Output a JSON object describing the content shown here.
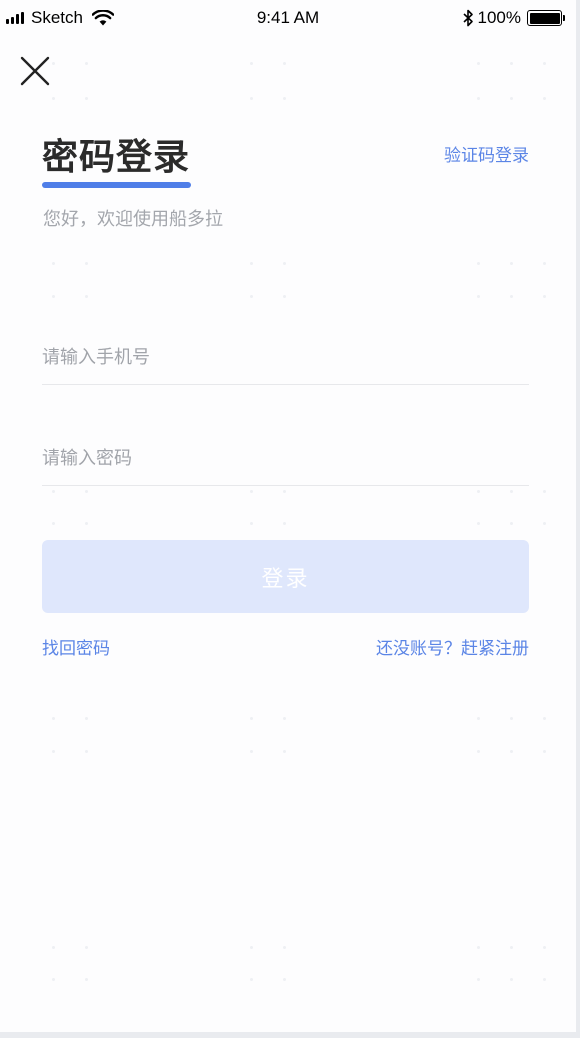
{
  "status_bar": {
    "carrier": "Sketch",
    "time": "9:41 AM",
    "battery": "100%"
  },
  "icons": {
    "close": "close-icon",
    "signal": "signal-bars-icon",
    "wifi": "wifi-icon",
    "bluetooth": "bluetooth-icon",
    "battery": "battery-icon"
  },
  "header": {
    "title": "密码登录",
    "alt_login_link": "验证码登录",
    "welcome": "您好，欢迎使用船多拉"
  },
  "form": {
    "phone_placeholder": "请输入手机号",
    "phone_value": "",
    "password_placeholder": "请输入密码",
    "password_value": "",
    "login_button": "登录"
  },
  "footer_links": {
    "forgot_password": "找回密码",
    "register": "还没账号？赶紧注册"
  },
  "colors": {
    "accent": "#5b85e6",
    "underline": "#4f7ee8",
    "button_disabled_bg": "#dfe7fc",
    "title_text": "#2b2b2b",
    "placeholder_text": "#a1a4aa"
  }
}
